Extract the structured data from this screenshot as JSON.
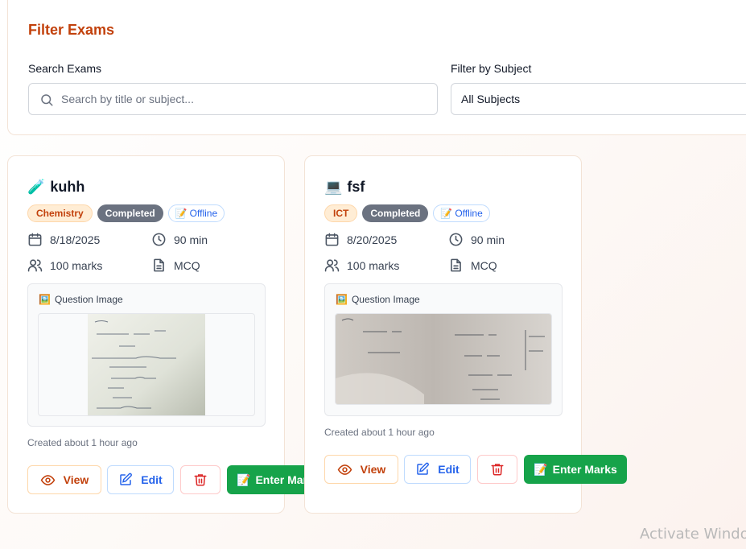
{
  "filters": {
    "title": "Filter Exams",
    "search_label": "Search Exams",
    "search_placeholder": "Search by title or subject...",
    "subject_label": "Filter by Subject",
    "subject_selected": "All Subjects"
  },
  "exams": [
    {
      "icon": "🧪",
      "title": "kuhh",
      "subject": "Chemistry",
      "status": "Completed",
      "mode": "Offline",
      "date": "8/18/2025",
      "duration": "90 min",
      "marks": "100 marks",
      "type": "MCQ",
      "image_label": "Question Image",
      "created": "Created about 1 hour ago",
      "actions": {
        "view": "View",
        "edit": "Edit",
        "enter_marks": "Enter Marks"
      }
    },
    {
      "icon": "💻",
      "title": "fsf",
      "subject": "ICT",
      "status": "Completed",
      "mode": "Offline",
      "date": "8/20/2025",
      "duration": "90 min",
      "marks": "100 marks",
      "type": "MCQ",
      "image_label": "Question Image",
      "created": "Created about 1 hour ago",
      "actions": {
        "view": "View",
        "edit": "Edit",
        "enter_marks": "Enter Marks"
      }
    }
  ],
  "watermark": "Activate Windo",
  "colors": {
    "accent": "#c2410c",
    "success": "#16a34a",
    "status_badge": "#6b7280",
    "link_blue": "#2563eb",
    "danger": "#dc2626"
  }
}
